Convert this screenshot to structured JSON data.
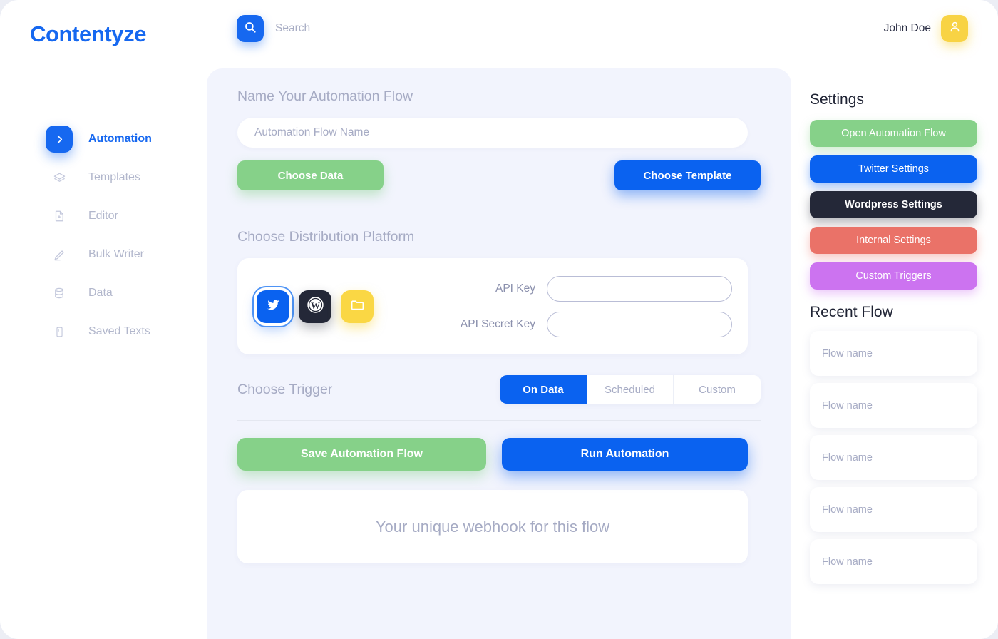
{
  "brand": "Contentyze",
  "topbar": {
    "search_icon": "search-icon",
    "search_placeholder": "Search",
    "user_name": "John Doe",
    "avatar_icon": "user-icon"
  },
  "sidebar": {
    "items": [
      {
        "label": "Automation",
        "icon": "chevron-right-icon",
        "active": true
      },
      {
        "label": "Templates",
        "icon": "layers-icon",
        "active": false
      },
      {
        "label": "Editor",
        "icon": "document-icon",
        "active": false
      },
      {
        "label": "Bulk Writer",
        "icon": "pen-icon",
        "active": false
      },
      {
        "label": "Data",
        "icon": "database-icon",
        "active": false
      },
      {
        "label": "Saved Texts",
        "icon": "book-icon",
        "active": false
      }
    ]
  },
  "main": {
    "name_section_title": "Name Your Automation Flow",
    "flow_name_value": "",
    "flow_name_placeholder": "Automation Flow Name",
    "choose_data_label": "Choose Data",
    "choose_template_label": "Choose Template",
    "platform_section_title": "Choose Distribution Platform",
    "platforms": [
      {
        "name": "twitter",
        "icon": "twitter-icon",
        "selected": true
      },
      {
        "name": "wordpress",
        "icon": "wordpress-icon",
        "selected": false
      },
      {
        "name": "folder",
        "icon": "folder-icon",
        "selected": false
      }
    ],
    "api_key_label": "API Key",
    "api_key_value": "",
    "api_secret_label": "API Secret Key",
    "api_secret_value": "",
    "trigger_label": "Choose Trigger",
    "triggers": [
      {
        "label": "On Data",
        "active": true
      },
      {
        "label": "Scheduled",
        "active": false
      },
      {
        "label": "Custom",
        "active": false
      }
    ],
    "save_label": "Save Automation Flow",
    "run_label": "Run Automation",
    "webhook_text": "Your unique webhook for this flow"
  },
  "right": {
    "settings_heading": "Settings",
    "settings_buttons": [
      {
        "label": "Open Automation Flow",
        "color": "#86d189"
      },
      {
        "label": "Twitter Settings",
        "color": "#0a62f0"
      },
      {
        "label": "Wordpress Settings",
        "color": "#242838"
      },
      {
        "label": "Internal Settings",
        "color": "#ea7268"
      },
      {
        "label": "Custom Triggers",
        "color": "#cc73f0"
      }
    ],
    "recent_heading": "Recent Flow",
    "recent_flows": [
      {
        "label": "Flow name"
      },
      {
        "label": "Flow name"
      },
      {
        "label": "Flow name"
      },
      {
        "label": "Flow name"
      },
      {
        "label": "Flow name"
      }
    ]
  },
  "colors": {
    "brand_blue": "#1668f0",
    "accent_blue": "#0a62f0",
    "green": "#86d189",
    "yellow": "#f8d344",
    "dark": "#242838",
    "red": "#ea7268",
    "purple": "#cc73f0",
    "panel_bg": "#f2f4fd",
    "muted_text": "#a6abc4"
  }
}
